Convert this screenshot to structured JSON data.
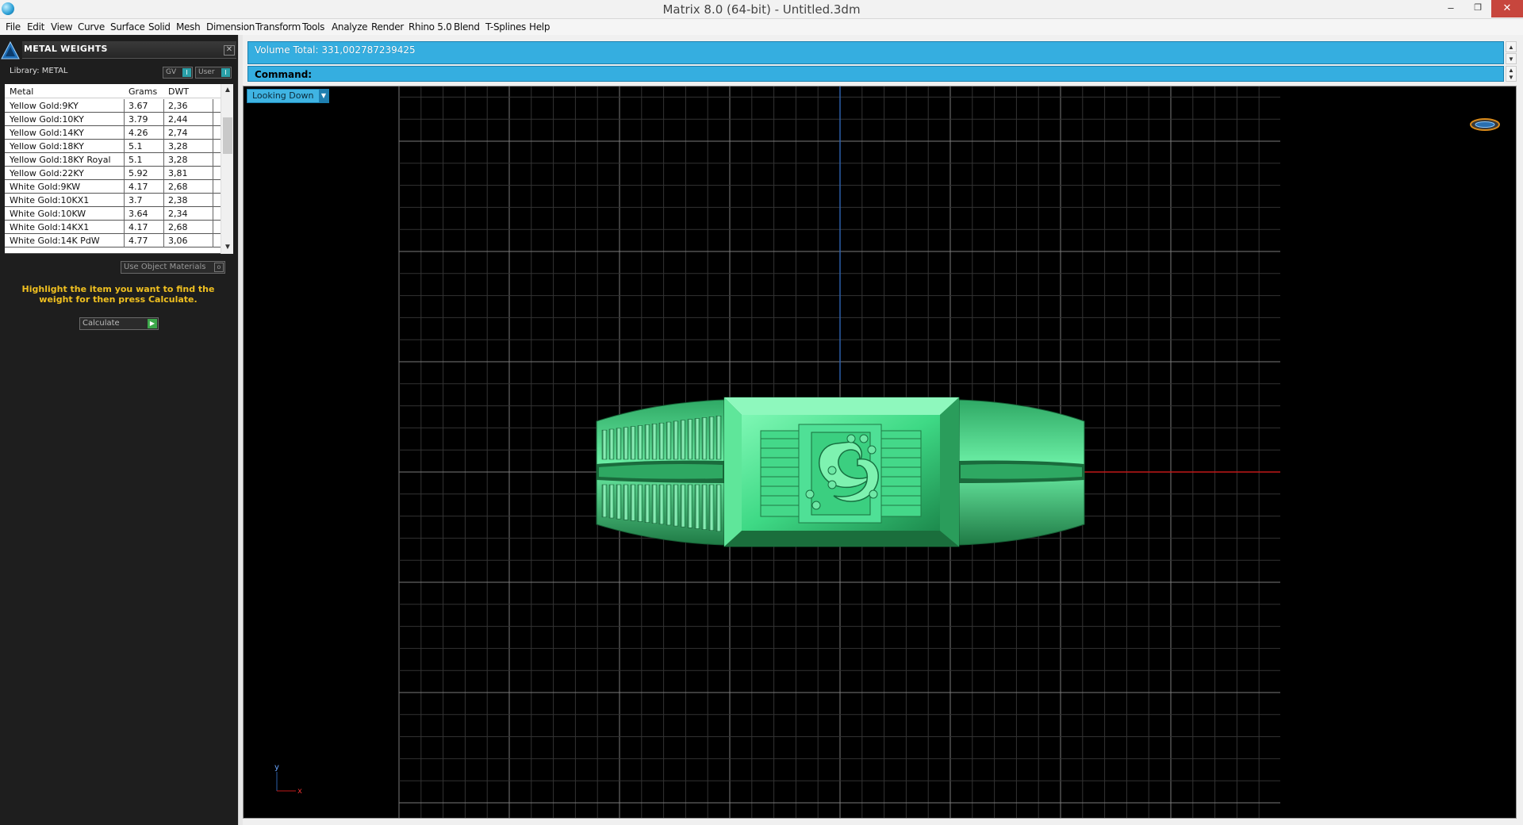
{
  "window": {
    "title": "Matrix 8.0 (64-bit) - Untitled.3dm",
    "min_label": "–",
    "max_label": "❐",
    "close_label": "✕"
  },
  "menu": [
    "File",
    "Edit",
    "View",
    "Curve",
    "Surface",
    "Solid",
    "Mesh",
    "Dimension",
    "Transform",
    "Tools",
    "Analyze",
    "Render",
    "Rhino 5.0",
    "Blend",
    "T-Splines",
    "Help"
  ],
  "panel": {
    "title": "METAL WEIGHTS",
    "close_label": "✕",
    "library_label": "Library: METAL",
    "gv_label": "GV",
    "user_label": "User",
    "columns": [
      "Metal",
      "Grams",
      "DWT"
    ],
    "rows": [
      [
        "Yellow Gold:9KY",
        "3.67",
        "2,36"
      ],
      [
        "Yellow Gold:10KY",
        "3.79",
        "2,44"
      ],
      [
        "Yellow Gold:14KY",
        "4.26",
        "2,74"
      ],
      [
        "Yellow Gold:18KY",
        "5.1",
        "3,28"
      ],
      [
        "Yellow Gold:18KY Royal",
        "5.1",
        "3,28"
      ],
      [
        "Yellow Gold:22KY",
        "5.92",
        "3,81"
      ],
      [
        "White Gold:9KW",
        "4.17",
        "2,68"
      ],
      [
        "White Gold:10KX1",
        "3.7",
        "2,38"
      ],
      [
        "White Gold:10KW",
        "3.64",
        "2,34"
      ],
      [
        "White Gold:14KX1",
        "4.17",
        "2,68"
      ],
      [
        "White Gold:14K PdW",
        "4.77",
        "3,06"
      ]
    ],
    "use_object_materials": "Use Object Materials",
    "hint": "Highlight the item you want to find the weight for then press Calculate.",
    "calculate_label": "Calculate"
  },
  "command": {
    "volume_text": "Volume Total: 331,002787239425",
    "command_label": "Command:"
  },
  "viewport": {
    "view_name": "Looking Down",
    "axis_y": "y",
    "axis_x": "x"
  },
  "colors": {
    "accent": "#35aee0",
    "panel_bg": "#1e1e1e",
    "hint": "#f0c020",
    "model_green": "#3ddc84",
    "axis_x": "#c01818",
    "axis_y": "#2b5ea8"
  }
}
